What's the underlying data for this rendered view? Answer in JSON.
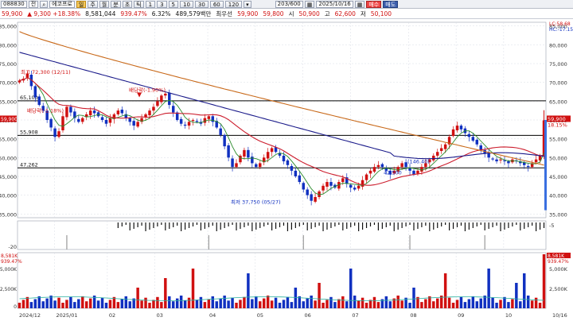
{
  "toolbar": {
    "code": "088830",
    "market": "전",
    "name": "에코프로",
    "periods": [
      "주",
      "월",
      "분",
      "초",
      "틱"
    ],
    "intervals": [
      "1",
      "3",
      "5",
      "10",
      "30",
      "60",
      "120"
    ],
    "count": "203/600",
    "date": "2025/10/16",
    "buy_label": "매수",
    "sell_label": "매도"
  },
  "quote": {
    "price": "59,900",
    "change": "9,300",
    "change_pct": "+18.38%",
    "volume": "8,581,044",
    "volume_pct": "939.47%",
    "turnover": "6.32%",
    "amount": "489,579백만",
    "extra": "최우선",
    "open_label": "시",
    "open": "50,900",
    "high_label": "고",
    "high": "62,600",
    "low_label": "저",
    "low": "50,100",
    "prev": "59,800"
  },
  "colors": {
    "up": "#d01010",
    "down": "#1030c0",
    "ma5": "#2a8a2a",
    "ma20": "#cc1c2c",
    "ma60": "#1a1a8a",
    "ma120": "#c86818",
    "volume_ma": "#2ab0a0"
  },
  "chart_data": {
    "type": "candlestick",
    "x_labels": [
      "2024/12",
      "2025/01",
      "02",
      "03",
      "04",
      "05",
      "06",
      "07",
      "08",
      "09",
      "10",
      "10/16"
    ],
    "price_axis": [
      "85,000",
      "80,000",
      "75,000",
      "70,000",
      "65,000",
      "60,000",
      "55,000",
      "50,000",
      "45,000",
      "40,000",
      "35,000"
    ],
    "ylim": [
      34000,
      86000
    ],
    "levels": [
      {
        "label": "65,100",
        "value": 65100
      },
      {
        "label": "55,908",
        "value": 55908
      },
      {
        "label": "47,262",
        "value": 47262
      }
    ],
    "current_price": {
      "label": "59,900",
      "pct": "18.15%",
      "value": 59900
    },
    "annotations": [
      {
        "text": "최고 72,300 (12/11)",
        "value": 72300
      },
      {
        "text": "배당락(-1.90%)",
        "value": 67500
      },
      {
        "text": "배당락(-1.18%)",
        "value": 62000
      },
      {
        "text": "최저 37,750 (05/27)",
        "value": 37750
      },
      {
        "text": "(146.40)",
        "value": 48500
      },
      {
        "text": "42,500",
        "value": 45500
      }
    ],
    "legend_right": [
      "LC:58.68",
      "HC:-17.15"
    ],
    "closes": [
      70500,
      71000,
      72300,
      69000,
      66000,
      64000,
      62500,
      60000,
      58000,
      55500,
      57000,
      61000,
      63500,
      62000,
      60500,
      59500,
      60500,
      61500,
      62500,
      61800,
      61000,
      60000,
      59000,
      60500,
      61500,
      62500,
      61800,
      60500,
      59500,
      58500,
      59500,
      60500,
      61500,
      62500,
      63500,
      65000,
      66500,
      67000,
      64000,
      62000,
      60000,
      59000,
      58500,
      59500,
      60000,
      59500,
      59000,
      60500,
      61000,
      59500,
      58000,
      56000,
      53000,
      50000,
      47500,
      48500,
      50500,
      52000,
      50000,
      48500,
      47500,
      48500,
      50000,
      51500,
      52500,
      51500,
      50500,
      49000,
      48000,
      46500,
      45000,
      43500,
      41500,
      40000,
      38500,
      39500,
      41000,
      42500,
      43500,
      42500,
      42000,
      43500,
      44500,
      43000,
      42000,
      41500,
      42500,
      44000,
      45500,
      46500,
      47500,
      48000,
      47500,
      46500,
      45500,
      46500,
      47500,
      48500,
      47500,
      46500,
      45500,
      46500,
      47500,
      48500,
      49500,
      50500,
      51500,
      52500,
      53500,
      55500,
      57500,
      58500,
      57500,
      56500,
      55500,
      54500,
      53500,
      52000,
      51000,
      50000,
      49500,
      49000,
      49500,
      49000,
      48500,
      49500,
      49000,
      48500,
      48000,
      47500,
      48500,
      49500,
      50600,
      59900
    ],
    "volume_axis": [
      "5,000K",
      "2,500K"
    ],
    "volume_pct_label": "939.47%",
    "volume_label": "8,581K",
    "volume_base": "0",
    "osc_axis": [
      "-5",
      "-20"
    ]
  }
}
